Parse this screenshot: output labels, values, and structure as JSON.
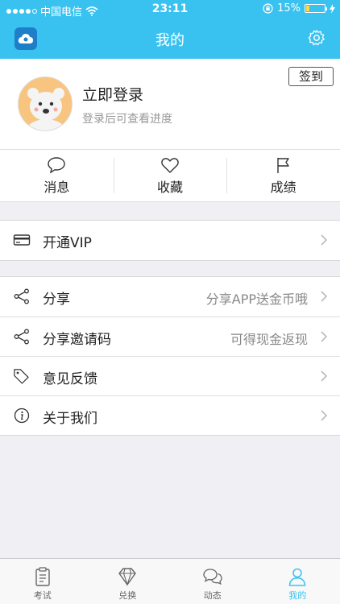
{
  "status_bar": {
    "carrier": "中国电信",
    "time": "23:11",
    "battery": "15%",
    "battery_level": 0.15
  },
  "navbar": {
    "title": "我的"
  },
  "profile": {
    "title": "立即登录",
    "subtitle": "登录后可查看进度",
    "sign_in_label": "签到"
  },
  "quick_actions": [
    {
      "label": "消息",
      "icon": "chat-bubble-icon"
    },
    {
      "label": "收藏",
      "icon": "heart-icon"
    },
    {
      "label": "成绩",
      "icon": "flag-icon"
    }
  ],
  "vip": {
    "label": "开通VIP",
    "icon": "card-icon"
  },
  "menu": [
    {
      "label": "分享",
      "value": "分享APP送金币哦",
      "icon": "share-icon"
    },
    {
      "label": "分享邀请码",
      "value": "可得现金返现",
      "icon": "share-icon"
    },
    {
      "label": "意见反馈",
      "value": "",
      "icon": "tag-icon"
    },
    {
      "label": "关于我们",
      "value": "",
      "icon": "info-icon"
    }
  ],
  "tabs": [
    {
      "label": "考试",
      "icon": "clipboard-icon",
      "active": false
    },
    {
      "label": "兑换",
      "icon": "diamond-icon",
      "active": false
    },
    {
      "label": "动态",
      "icon": "chat-icon",
      "active": false
    },
    {
      "label": "我的",
      "icon": "person-icon",
      "active": true
    }
  ],
  "colors": {
    "accent": "#39c2f0",
    "app_icon_bg": "#1e7fc8",
    "background": "#efeff4",
    "battery": "#ffd84a"
  }
}
